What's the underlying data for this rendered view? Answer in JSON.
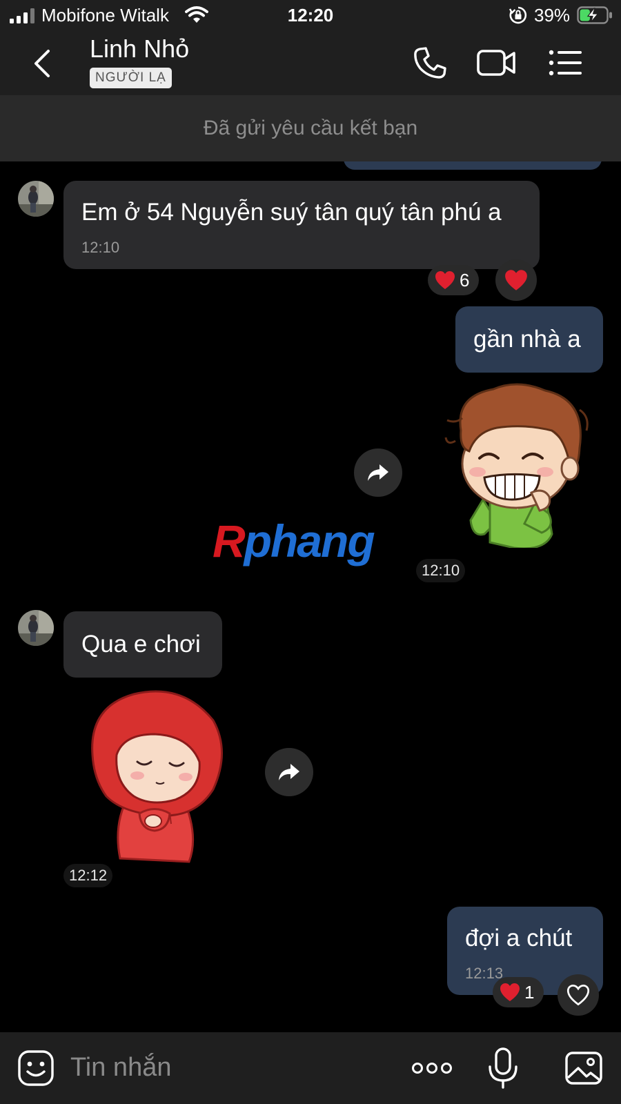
{
  "status_bar": {
    "carrier": "Mobifone Witalk",
    "time": "12:20",
    "battery": "39%",
    "battery_level": 0.39
  },
  "header": {
    "contact_name": "Linh Nhỏ",
    "badge": "NGƯỜI LẠ",
    "icons": [
      "back-icon",
      "phone-icon",
      "video-call-icon",
      "menu-list-icon"
    ]
  },
  "friend_request_notice": "Đã gửi yêu cầu kết bạn",
  "messages": {
    "m1": {
      "sender": "Linh Nhỏ",
      "text": "Em ở 54 Nguyễn suý tân quý tân phú a",
      "time": "12:10",
      "reaction_count": "6"
    },
    "m2": {
      "sender": "me",
      "text": "gần nhà a"
    },
    "m3": {
      "sender": "me",
      "type": "sticker",
      "sticker": "smiling-boy-sticker",
      "time": "12:10"
    },
    "m4": {
      "sender": "Linh Nhỏ",
      "text": "Qua e chơi"
    },
    "m5": {
      "sender": "Linh Nhỏ",
      "type": "sticker",
      "sticker": "red-hood-girl-sticker",
      "time": "12:12"
    },
    "m6": {
      "sender": "me",
      "text": "đợi a chút",
      "time": "12:13",
      "reaction_count": "1"
    }
  },
  "watermark": {
    "first": "R",
    "rest": "phang"
  },
  "input_bar": {
    "placeholder": "Tin nhắn",
    "icons": [
      "emoji-icon",
      "more-options-icon",
      "microphone-icon",
      "image-icon"
    ]
  },
  "colors": {
    "background": "#000000",
    "bar_background": "#1f1f1f",
    "incoming_bubble": "#2b2b2d",
    "outgoing_bubble": "#2c3b52",
    "heart": "#e0202f",
    "battery_charge": "#4cd964"
  }
}
